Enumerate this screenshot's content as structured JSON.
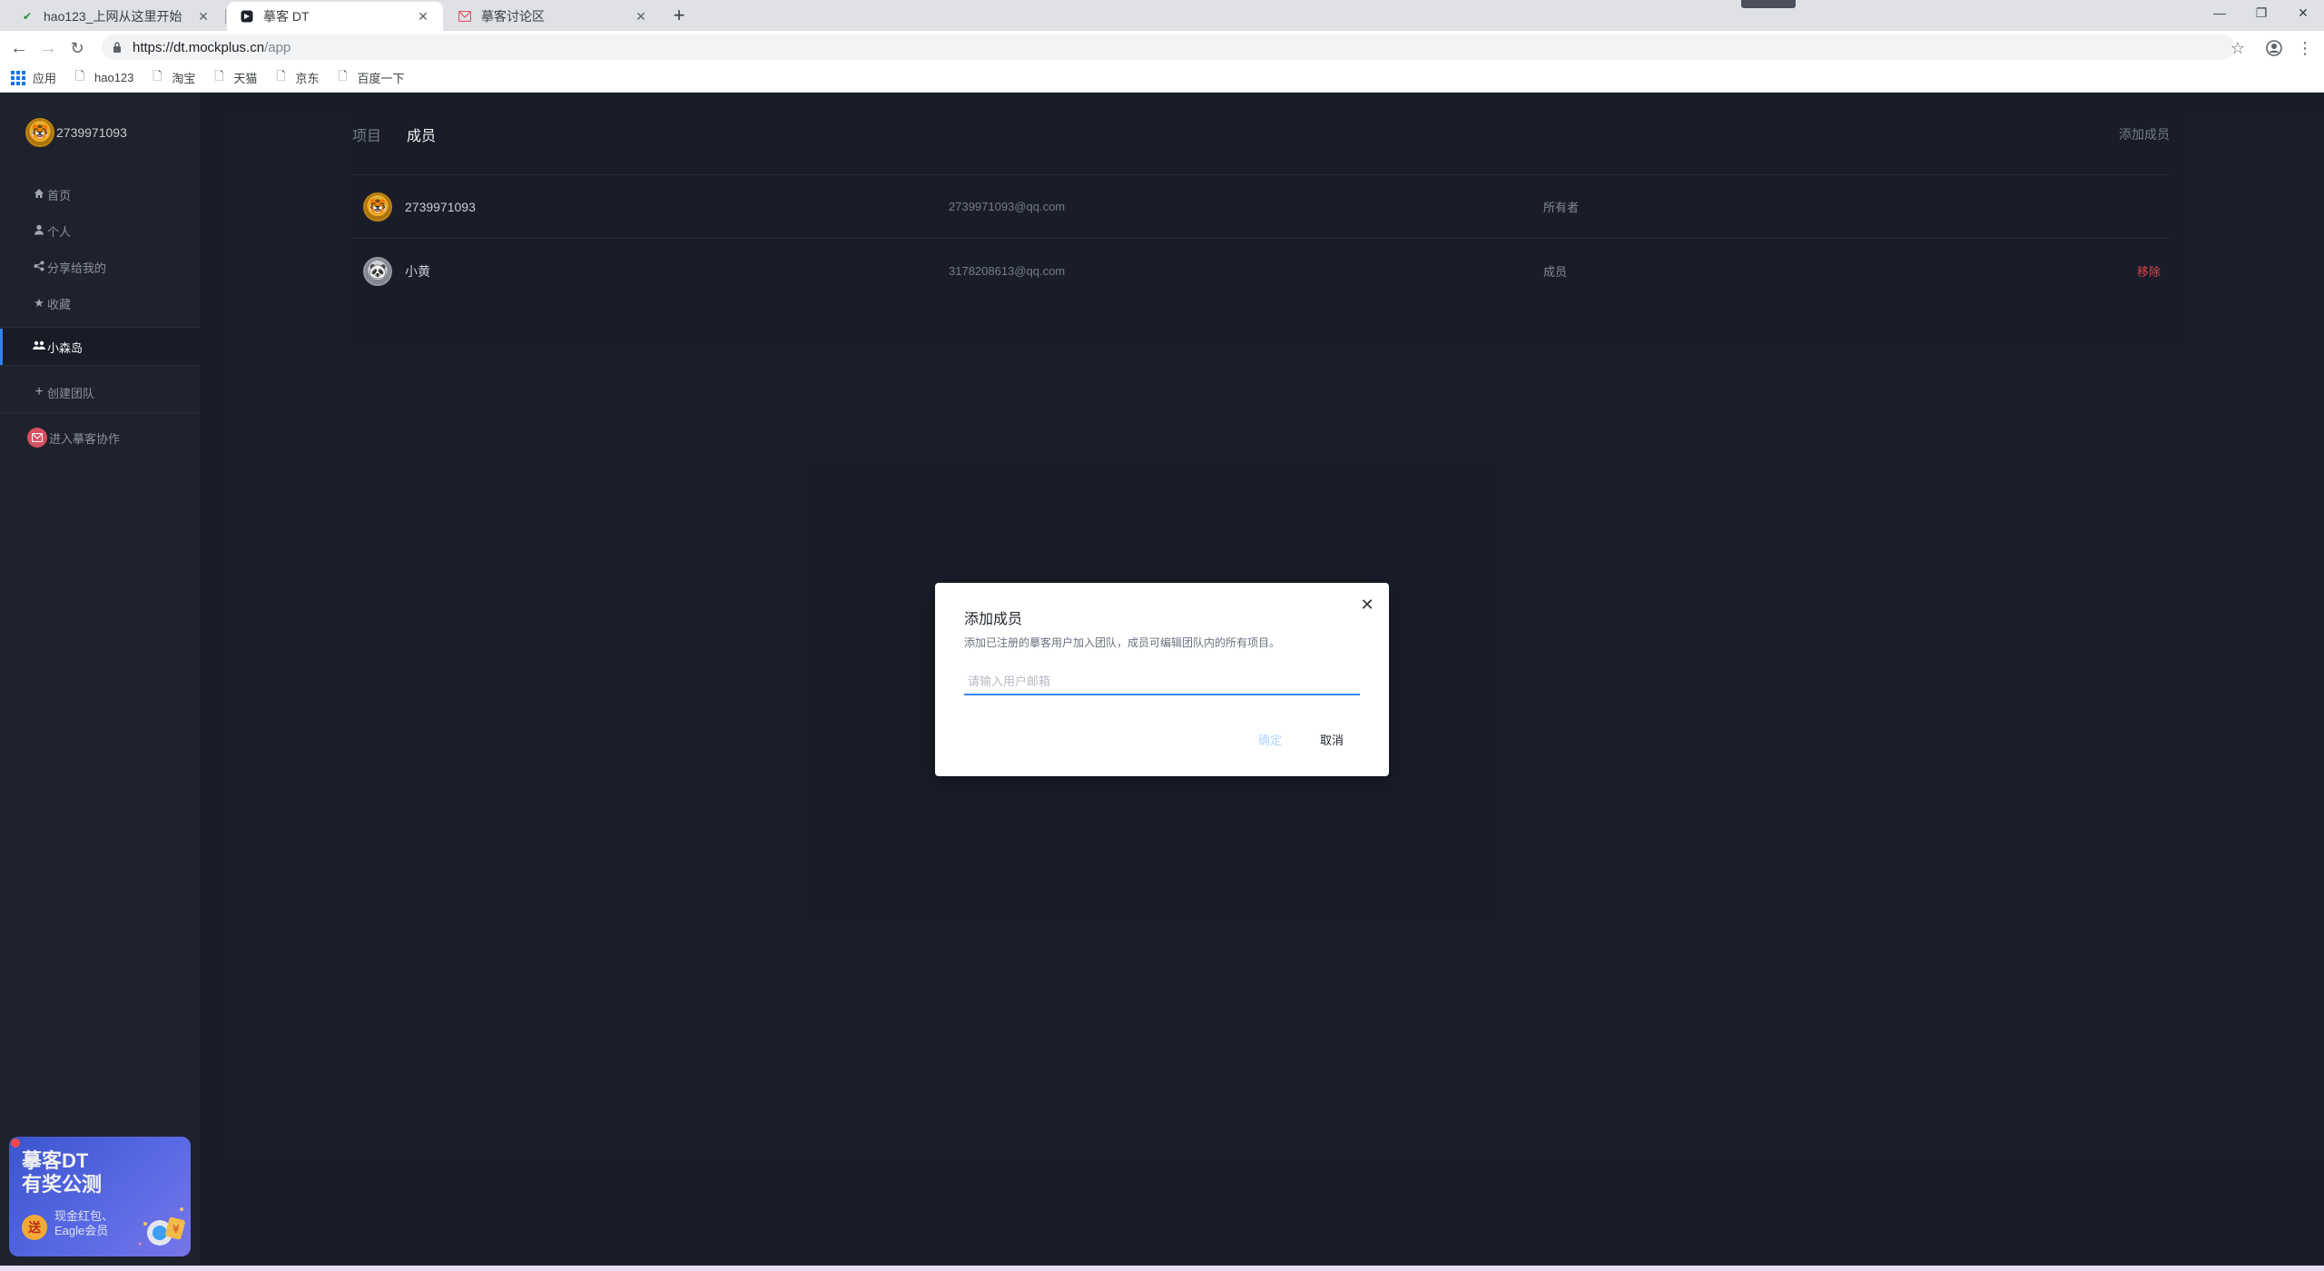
{
  "browser": {
    "tabs": [
      {
        "title": "hao123_上网从这里开始",
        "active": false
      },
      {
        "title": "摹客 DT",
        "active": true
      },
      {
        "title": "摹客讨论区",
        "active": false
      }
    ],
    "url_host": "https://dt.mockplus.cn",
    "url_path": "/app",
    "bookmarks": [
      {
        "label": "应用",
        "icon": "apps-grid-icon"
      },
      {
        "label": "hao123",
        "icon": "page-icon"
      },
      {
        "label": "淘宝",
        "icon": "page-icon"
      },
      {
        "label": "天猫",
        "icon": "page-icon"
      },
      {
        "label": "京东",
        "icon": "page-icon"
      },
      {
        "label": "百度一下",
        "icon": "page-icon"
      }
    ]
  },
  "sidebar": {
    "username": "2739971093",
    "items": [
      {
        "label": "首页",
        "icon": "home-icon"
      },
      {
        "label": "个人",
        "icon": "user-icon"
      },
      {
        "label": "分享给我的",
        "icon": "share-icon"
      },
      {
        "label": "收藏",
        "icon": "star-icon"
      }
    ],
    "team": {
      "label": "小森岛",
      "icon": "team-icon",
      "active": true
    },
    "create_team": "创建团队",
    "collab": "进入摹客协作",
    "promo": {
      "title_line1": "摹客DT",
      "title_line2": "有奖公测",
      "gift": "送",
      "sub_line1": "现金红包、",
      "sub_line2": "Eagle会员"
    }
  },
  "main": {
    "tabs": [
      {
        "label": "项目",
        "active": false
      },
      {
        "label": "成员",
        "active": true
      }
    ],
    "add_member": "添加成员",
    "members": [
      {
        "name": "2739971093",
        "email": "2739971093@qq.com",
        "role": "所有者",
        "action": ""
      },
      {
        "name": "小黄",
        "email": "3178208613@qq.com",
        "role": "成员",
        "action": "移除"
      }
    ]
  },
  "modal": {
    "title": "添加成员",
    "description": "添加已注册的摹客用户加入团队，成员可编辑团队内的所有项目。",
    "input_placeholder": "请输入用户邮箱",
    "input_value": "",
    "ok": "确定",
    "cancel": "取消"
  },
  "colors": {
    "accent": "#3a86ff",
    "danger": "#e5484d",
    "sidebar_bg": "#20242f",
    "main_bg": "#1b1f2c"
  }
}
